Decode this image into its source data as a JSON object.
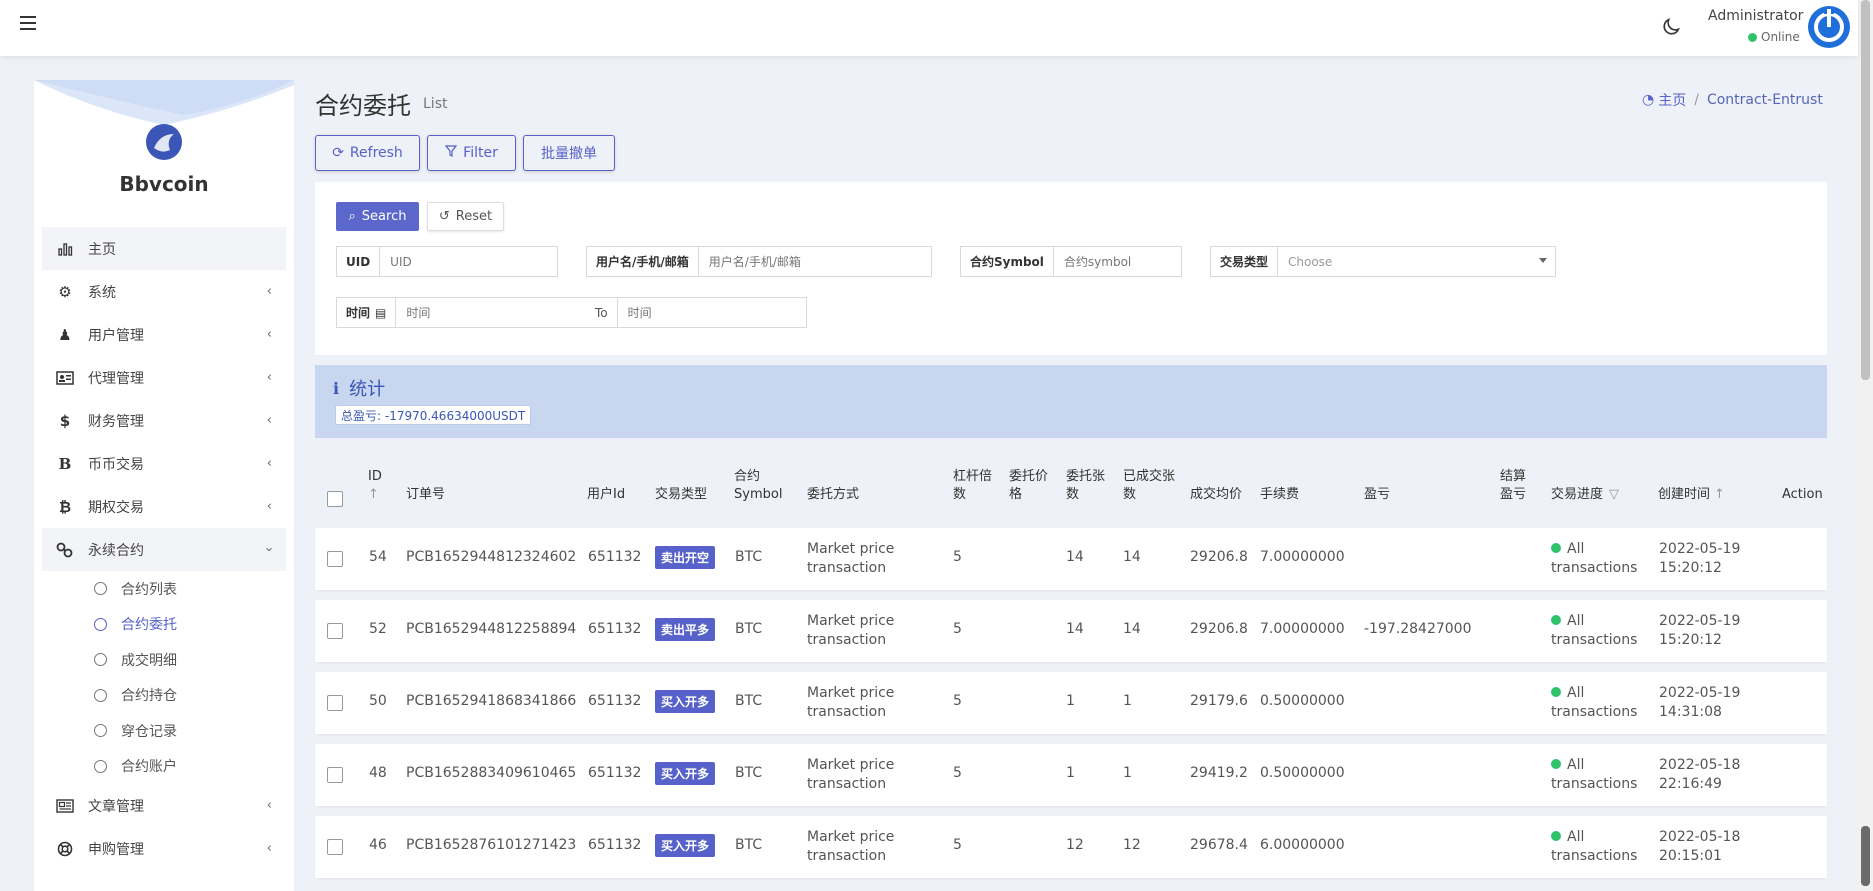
{
  "topbar": {
    "admin_name": "Administrator",
    "admin_status": "Online"
  },
  "sidebar": {
    "brand": "Bbvcoin",
    "items": [
      {
        "label": "主页",
        "icon": "bar-chart-icon"
      },
      {
        "label": "系统",
        "icon": "gear-icon"
      },
      {
        "label": "用户管理",
        "icon": "users-icon"
      },
      {
        "label": "代理管理",
        "icon": "id-card-icon"
      },
      {
        "label": "财务管理",
        "icon": "dollar-icon"
      },
      {
        "label": "币币交易",
        "icon": "b-icon"
      },
      {
        "label": "期权交易",
        "icon": "bitcoin-icon"
      },
      {
        "label": "永续合约",
        "icon": "link-icon"
      }
    ],
    "submenu": [
      "合约列表",
      "合约委托",
      "成交明细",
      "合约持仓",
      "穿仓记录",
      "合约账户"
    ],
    "items_after": [
      {
        "label": "文章管理",
        "icon": "newspaper-icon"
      },
      {
        "label": "申购管理",
        "icon": "lifebuoy-icon"
      }
    ]
  },
  "page": {
    "title": "合约委托",
    "subtitle": "List",
    "breadcrumb_home": "主页",
    "breadcrumb_current": "Contract-Entrust"
  },
  "toolbar": {
    "refresh": "Refresh",
    "filter": "Filter",
    "batch_cancel": "批量撤单"
  },
  "filters": {
    "search": "Search",
    "reset": "Reset",
    "uid_label": "UID",
    "uid_placeholder": "UID",
    "user_label": "用户名/手机/邮箱",
    "user_placeholder": "用户名/手机/邮箱",
    "symbol_label": "合约Symbol",
    "symbol_placeholder": "合约symbol",
    "type_label": "交易类型",
    "type_value": "Choose",
    "time_label": "时间",
    "time_from_placeholder": "时间",
    "time_to": "To",
    "time_to_placeholder": "时间"
  },
  "stats": {
    "title": "统计",
    "total": "总盈亏: -17970.46634000USDT"
  },
  "table": {
    "headers": {
      "id": "ID",
      "order_no": "订单号",
      "user_id": "用户Id",
      "trade_type": "交易类型",
      "symbol_1": "合约",
      "symbol_2": "Symbol",
      "method": "委托方式",
      "leverage_1": "杠杆倍",
      "leverage_2": "数",
      "price_1": "委托价",
      "price_2": "格",
      "qty_1": "委托张",
      "qty_2": "数",
      "filled_1": "已成交张",
      "filled_2": "数",
      "avg_price": "成交均价",
      "fee": "手续费",
      "pnl": "盈亏",
      "settle_1": "结算",
      "settle_2": "盈亏",
      "progress": "交易进度",
      "created": "创建时间",
      "action": "Action"
    },
    "rows": [
      {
        "id": "54",
        "order": "PCB1652944812324602",
        "uid": "651132",
        "type": "卖出开空",
        "symbol": "BTC",
        "method_1": "Market price",
        "method_2": "transaction",
        "leverage": "5",
        "price": "",
        "qty": "14",
        "filled": "14",
        "avg": "29206.8",
        "fee": "7.00000000",
        "pnl": "",
        "settle": "",
        "prog_1": "All",
        "prog_2": "transactions",
        "date": "2022-05-19",
        "time": "15:20:12"
      },
      {
        "id": "52",
        "order": "PCB1652944812258894",
        "uid": "651132",
        "type": "卖出平多",
        "symbol": "BTC",
        "method_1": "Market price",
        "method_2": "transaction",
        "leverage": "5",
        "price": "",
        "qty": "14",
        "filled": "14",
        "avg": "29206.8",
        "fee": "7.00000000",
        "pnl": "-197.28427000",
        "settle": "",
        "prog_1": "All",
        "prog_2": "transactions",
        "date": "2022-05-19",
        "time": "15:20:12"
      },
      {
        "id": "50",
        "order": "PCB1652941868341866",
        "uid": "651132",
        "type": "买入开多",
        "symbol": "BTC",
        "method_1": "Market price",
        "method_2": "transaction",
        "leverage": "5",
        "price": "",
        "qty": "1",
        "filled": "1",
        "avg": "29179.6",
        "fee": "0.50000000",
        "pnl": "",
        "settle": "",
        "prog_1": "All",
        "prog_2": "transactions",
        "date": "2022-05-19",
        "time": "14:31:08"
      },
      {
        "id": "48",
        "order": "PCB1652883409610465",
        "uid": "651132",
        "type": "买入开多",
        "symbol": "BTC",
        "method_1": "Market price",
        "method_2": "transaction",
        "leverage": "5",
        "price": "",
        "qty": "1",
        "filled": "1",
        "avg": "29419.2",
        "fee": "0.50000000",
        "pnl": "",
        "settle": "",
        "prog_1": "All",
        "prog_2": "transactions",
        "date": "2022-05-18",
        "time": "22:16:49"
      },
      {
        "id": "46",
        "order": "PCB1652876101271423",
        "uid": "651132",
        "type": "买入开多",
        "symbol": "BTC",
        "method_1": "Market price",
        "method_2": "transaction",
        "leverage": "5",
        "price": "",
        "qty": "12",
        "filled": "12",
        "avg": "29678.4",
        "fee": "6.00000000",
        "pnl": "",
        "settle": "",
        "prog_1": "All",
        "prog_2": "transactions",
        "date": "2022-05-18",
        "time": "20:15:01"
      }
    ]
  },
  "colors": {
    "accent": "#5661c9",
    "success": "#2ec26a",
    "stats_bg": "#c9d6ef"
  }
}
